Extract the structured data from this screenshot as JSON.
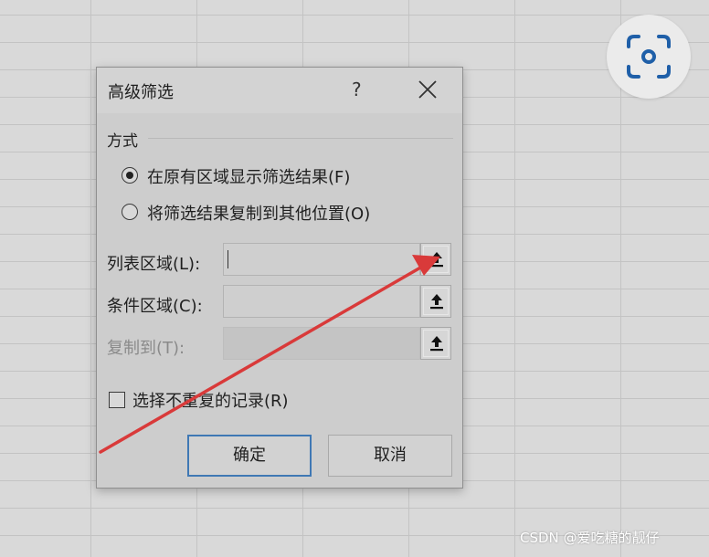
{
  "dialog": {
    "title": "高级筛选",
    "help_label": "?",
    "section_label": "方式",
    "radio_options": [
      {
        "label": "在原有区域显示筛选结果(F)",
        "selected": true
      },
      {
        "label": "将筛选结果复制到其他位置(O)",
        "selected": false
      }
    ],
    "fields": [
      {
        "label": "列表区域(L):",
        "value": "",
        "enabled": true
      },
      {
        "label": "条件区域(C):",
        "value": "",
        "enabled": true
      },
      {
        "label": "复制到(T):",
        "value": "",
        "enabled": false
      }
    ],
    "unique_checkbox": {
      "label": "选择不重复的记录(R)",
      "checked": false
    },
    "ok_label": "确定",
    "cancel_label": "取消"
  },
  "annotation": {
    "color": "#d93a3a"
  },
  "accent_color": "#3f78b4",
  "icons": {
    "close": "close-icon",
    "collapse": "collapse-dialog-icon",
    "lens": "google-lens-icon"
  },
  "watermark": "CSDN @爱吃糖的靓仔"
}
